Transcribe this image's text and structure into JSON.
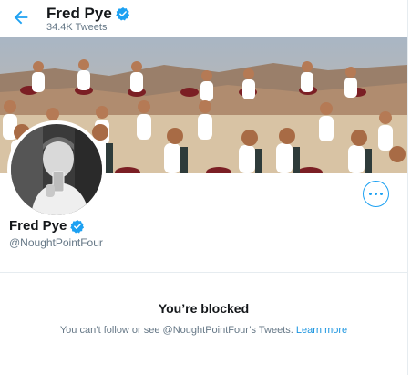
{
  "header": {
    "back_icon": "arrow-left-icon",
    "name": "Fred Pye",
    "tweet_count": "34.4K Tweets",
    "verified_icon": "verified-badge-icon"
  },
  "profile": {
    "name": "Fred Pye",
    "handle": "@NoughtPointFour",
    "more_icon": "more-options-icon"
  },
  "blocked": {
    "title": "You’re blocked",
    "message": "You can’t follow or see @NoughtPointFour’s Tweets.",
    "link": "Learn more"
  },
  "colors": {
    "accent": "#1da1f2",
    "secondary_text": "#657786",
    "divider": "#e6ecf0"
  }
}
